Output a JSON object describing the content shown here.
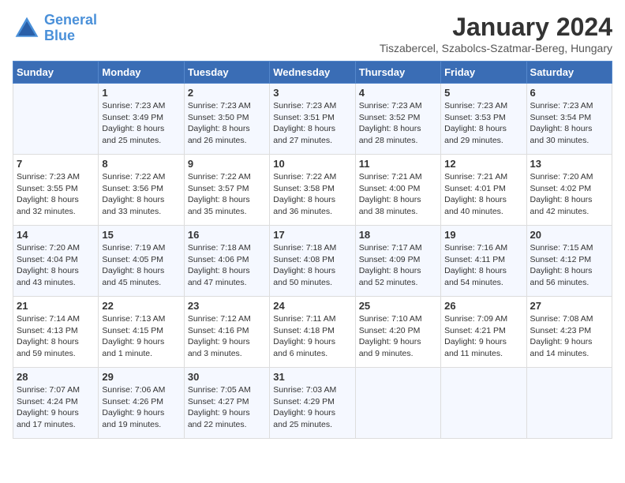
{
  "header": {
    "logo_line1": "General",
    "logo_line2": "Blue",
    "month_year": "January 2024",
    "location": "Tiszabercel, Szabolcs-Szatmar-Bereg, Hungary"
  },
  "days_of_week": [
    "Sunday",
    "Monday",
    "Tuesday",
    "Wednesday",
    "Thursday",
    "Friday",
    "Saturday"
  ],
  "weeks": [
    [
      {
        "day": "",
        "data": ""
      },
      {
        "day": "1",
        "data": "Sunrise: 7:23 AM\nSunset: 3:49 PM\nDaylight: 8 hours\nand 25 minutes."
      },
      {
        "day": "2",
        "data": "Sunrise: 7:23 AM\nSunset: 3:50 PM\nDaylight: 8 hours\nand 26 minutes."
      },
      {
        "day": "3",
        "data": "Sunrise: 7:23 AM\nSunset: 3:51 PM\nDaylight: 8 hours\nand 27 minutes."
      },
      {
        "day": "4",
        "data": "Sunrise: 7:23 AM\nSunset: 3:52 PM\nDaylight: 8 hours\nand 28 minutes."
      },
      {
        "day": "5",
        "data": "Sunrise: 7:23 AM\nSunset: 3:53 PM\nDaylight: 8 hours\nand 29 minutes."
      },
      {
        "day": "6",
        "data": "Sunrise: 7:23 AM\nSunset: 3:54 PM\nDaylight: 8 hours\nand 30 minutes."
      }
    ],
    [
      {
        "day": "7",
        "data": "Sunrise: 7:23 AM\nSunset: 3:55 PM\nDaylight: 8 hours\nand 32 minutes."
      },
      {
        "day": "8",
        "data": "Sunrise: 7:22 AM\nSunset: 3:56 PM\nDaylight: 8 hours\nand 33 minutes."
      },
      {
        "day": "9",
        "data": "Sunrise: 7:22 AM\nSunset: 3:57 PM\nDaylight: 8 hours\nand 35 minutes."
      },
      {
        "day": "10",
        "data": "Sunrise: 7:22 AM\nSunset: 3:58 PM\nDaylight: 8 hours\nand 36 minutes."
      },
      {
        "day": "11",
        "data": "Sunrise: 7:21 AM\nSunset: 4:00 PM\nDaylight: 8 hours\nand 38 minutes."
      },
      {
        "day": "12",
        "data": "Sunrise: 7:21 AM\nSunset: 4:01 PM\nDaylight: 8 hours\nand 40 minutes."
      },
      {
        "day": "13",
        "data": "Sunrise: 7:20 AM\nSunset: 4:02 PM\nDaylight: 8 hours\nand 42 minutes."
      }
    ],
    [
      {
        "day": "14",
        "data": "Sunrise: 7:20 AM\nSunset: 4:04 PM\nDaylight: 8 hours\nand 43 minutes."
      },
      {
        "day": "15",
        "data": "Sunrise: 7:19 AM\nSunset: 4:05 PM\nDaylight: 8 hours\nand 45 minutes."
      },
      {
        "day": "16",
        "data": "Sunrise: 7:18 AM\nSunset: 4:06 PM\nDaylight: 8 hours\nand 47 minutes."
      },
      {
        "day": "17",
        "data": "Sunrise: 7:18 AM\nSunset: 4:08 PM\nDaylight: 8 hours\nand 50 minutes."
      },
      {
        "day": "18",
        "data": "Sunrise: 7:17 AM\nSunset: 4:09 PM\nDaylight: 8 hours\nand 52 minutes."
      },
      {
        "day": "19",
        "data": "Sunrise: 7:16 AM\nSunset: 4:11 PM\nDaylight: 8 hours\nand 54 minutes."
      },
      {
        "day": "20",
        "data": "Sunrise: 7:15 AM\nSunset: 4:12 PM\nDaylight: 8 hours\nand 56 minutes."
      }
    ],
    [
      {
        "day": "21",
        "data": "Sunrise: 7:14 AM\nSunset: 4:13 PM\nDaylight: 8 hours\nand 59 minutes."
      },
      {
        "day": "22",
        "data": "Sunrise: 7:13 AM\nSunset: 4:15 PM\nDaylight: 9 hours\nand 1 minute."
      },
      {
        "day": "23",
        "data": "Sunrise: 7:12 AM\nSunset: 4:16 PM\nDaylight: 9 hours\nand 3 minutes."
      },
      {
        "day": "24",
        "data": "Sunrise: 7:11 AM\nSunset: 4:18 PM\nDaylight: 9 hours\nand 6 minutes."
      },
      {
        "day": "25",
        "data": "Sunrise: 7:10 AM\nSunset: 4:20 PM\nDaylight: 9 hours\nand 9 minutes."
      },
      {
        "day": "26",
        "data": "Sunrise: 7:09 AM\nSunset: 4:21 PM\nDaylight: 9 hours\nand 11 minutes."
      },
      {
        "day": "27",
        "data": "Sunrise: 7:08 AM\nSunset: 4:23 PM\nDaylight: 9 hours\nand 14 minutes."
      }
    ],
    [
      {
        "day": "28",
        "data": "Sunrise: 7:07 AM\nSunset: 4:24 PM\nDaylight: 9 hours\nand 17 minutes."
      },
      {
        "day": "29",
        "data": "Sunrise: 7:06 AM\nSunset: 4:26 PM\nDaylight: 9 hours\nand 19 minutes."
      },
      {
        "day": "30",
        "data": "Sunrise: 7:05 AM\nSunset: 4:27 PM\nDaylight: 9 hours\nand 22 minutes."
      },
      {
        "day": "31",
        "data": "Sunrise: 7:03 AM\nSunset: 4:29 PM\nDaylight: 9 hours\nand 25 minutes."
      },
      {
        "day": "",
        "data": ""
      },
      {
        "day": "",
        "data": ""
      },
      {
        "day": "",
        "data": ""
      }
    ]
  ]
}
